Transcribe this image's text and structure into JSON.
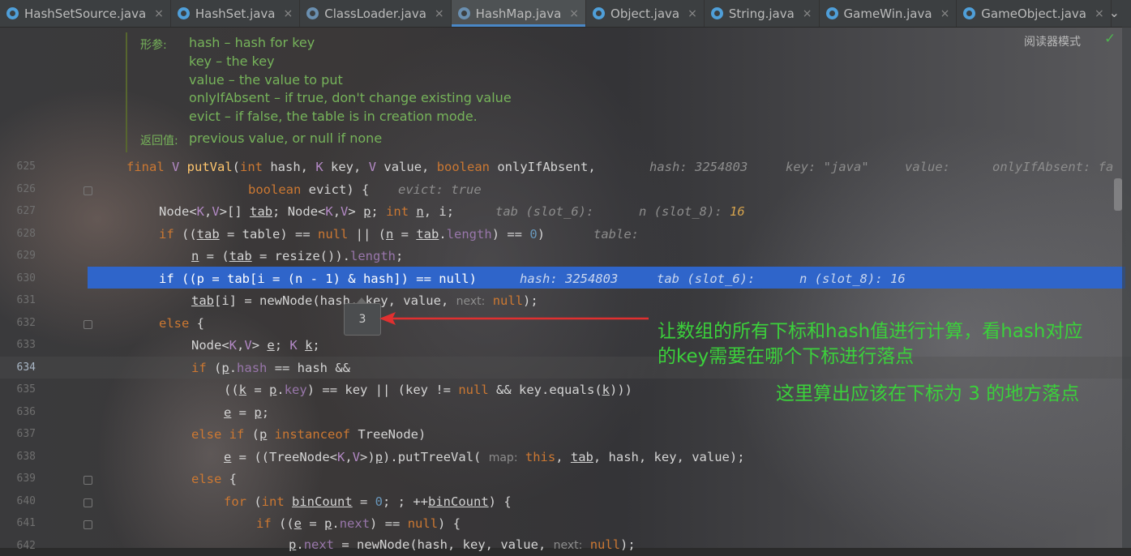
{
  "tabs": [
    {
      "label": "HashSetSource.java",
      "icon": "class-icon",
      "active": false
    },
    {
      "label": "HashSet.java",
      "icon": "class-icon",
      "active": false
    },
    {
      "label": "ClassLoader.java",
      "icon": "library-class-icon",
      "active": false
    },
    {
      "label": "HashMap.java",
      "icon": "library-class-icon",
      "active": true
    },
    {
      "label": "Object.java",
      "icon": "class-icon",
      "active": false
    },
    {
      "label": "String.java",
      "icon": "class-icon",
      "active": false
    },
    {
      "label": "GameWin.java",
      "icon": "class-icon",
      "active": false
    },
    {
      "label": "GameObject.java",
      "icon": "class-icon",
      "active": false
    }
  ],
  "tab_close": "×",
  "more_tabs": "⌄",
  "reader_mode": "阅读器模式",
  "reader_check": "✓",
  "doc": {
    "params_label": "形参:",
    "params": [
      "hash – hash for key",
      "key – the key",
      "value – the value to put",
      "onlyIfAbsent – if true, don't change existing value",
      "evict – if false, the table is in creation mode."
    ],
    "returns_label": "返回值:",
    "returns": "previous value, or null if none"
  },
  "line_numbers": [
    "625",
    "626",
    "627",
    "628",
    "629",
    "630",
    "631",
    "632",
    "633",
    "634",
    "635",
    "636",
    "637",
    "638",
    "639",
    "640",
    "641",
    "642"
  ],
  "code": {
    "l625": {
      "final": "final ",
      "V": "V ",
      "name": "putVal",
      "rest1": "(",
      "int": "int",
      "rest2": " hash, ",
      "K": "K",
      "rest3": " key, ",
      "V2": "V",
      "rest4": " value, ",
      "boolean": "boolean",
      "rest5": " onlyIfAbsent,",
      "h1": "hash: 3254803",
      "h2": "key: \"java\"",
      "h3": "value:",
      "h4": "onlyIfAbsent: fa"
    },
    "l626": {
      "boolean": "boolean",
      "rest": " evict) {",
      "hint": "evict: true"
    },
    "l627": {
      "a": "Node<",
      "K": "K",
      "c": ",",
      "V": "V",
      "b": ">[] ",
      "tab": "tab",
      "d": "; Node<",
      "K2": "K",
      "e": ",",
      "V2": "V",
      "f": "> ",
      "p": "p",
      "g": "; ",
      "int": "int",
      "h": " ",
      "n": "n",
      "i": ", i;",
      "hint1": "tab (slot_6):",
      "hint2": "n (slot_8):",
      "hint2v": "16"
    },
    "l628": {
      "if": "if",
      "a": " ((",
      "tab": "tab",
      "b": " = table) == ",
      "null": "null",
      "c": " || (",
      "n": "n",
      "d": " = ",
      "tab2": "tab",
      "e": ".",
      "length": "length",
      "f": ") == ",
      "zero": "0",
      "g": ")",
      "hint": "table:"
    },
    "l629": {
      "n": "n",
      "a": " = (",
      "tab": "tab",
      "b": " = resize()).",
      "length": "length",
      "c": ";"
    },
    "l630": {
      "text": "if ((p = tab[i = (n - 1) & hash]) == null)",
      "hint1": "hash: 3254803",
      "hint2": "tab (slot_6):",
      "hint3": "n (slot_8): 16"
    },
    "l631": {
      "tab": "tab",
      "a": "[i] = newNode(hash, key, value, ",
      "inl": "next:",
      "null": "null",
      "b": ");"
    },
    "l632": {
      "else": "else",
      "a": " {"
    },
    "l633": {
      "a": "Node<",
      "K": "K",
      "c": ",",
      "V": "V",
      "b": "> ",
      "e": "e",
      "d": "; ",
      "K2": "K",
      "f": " ",
      "k": "k",
      "g": ";"
    },
    "l634": {
      "if": "if",
      "a": " (",
      "p": "p",
      "b": ".",
      "hash": "hash",
      "c": " == hash &&"
    },
    "l635": {
      "a": "((",
      "k": "k",
      "b": " = ",
      "p": "p",
      "c": ".",
      "key": "key",
      "d": ") == key || (key != ",
      "null": "null",
      "e": " && key.equals(",
      "k2": "k",
      "f": ")))"
    },
    "l636": {
      "e": "e",
      "a": " = ",
      "p": "p",
      "b": ";"
    },
    "l637": {
      "else": "else",
      "if": " if",
      "a": " (",
      "p": "p",
      "inst": " instanceof",
      "b": " TreeNode)"
    },
    "l638": {
      "e": "e",
      "a": " = ((TreeNode<",
      "K": "K",
      "c": ",",
      "V": "V",
      "b": ">)",
      "p": "p",
      "d": ").putTreeVal(",
      "inl": "map:",
      "this": "this",
      "comma": ", ",
      "tab": "tab",
      "f": ", hash, key, value);"
    },
    "l639": {
      "else": "else",
      "a": " {"
    },
    "l640": {
      "for": "for",
      "a": " (",
      "int": "int",
      "b": " ",
      "bc": "binCount",
      "c": " = ",
      "zero": "0",
      "d": "; ; ++",
      "bc2": "binCount",
      "e": ") {"
    },
    "l641": {
      "if": "if",
      "a": " ((",
      "e": "e",
      "b": " = ",
      "p": "p",
      "c": ".",
      "next": "next",
      "d": ") == ",
      "null": "null",
      "f": ") {"
    },
    "l642": {
      "p": "p",
      "a": ".",
      "next": "next",
      "b": " = newNode(hash, key, value, ",
      "inl": "next:",
      "null": "null",
      "c": ");"
    }
  },
  "tooltip_value": "3",
  "annotations": {
    "line1": "让数组的所有下标和hash值进行计算，看hash对应",
    "line2": "的key需要在哪个下标进行落点",
    "line3": "这里算出应该在下标为 3 的地方落点"
  },
  "colors": {
    "annotation": "#3bd13b",
    "arrow": "#e03030",
    "selection": "#2f65ca"
  }
}
